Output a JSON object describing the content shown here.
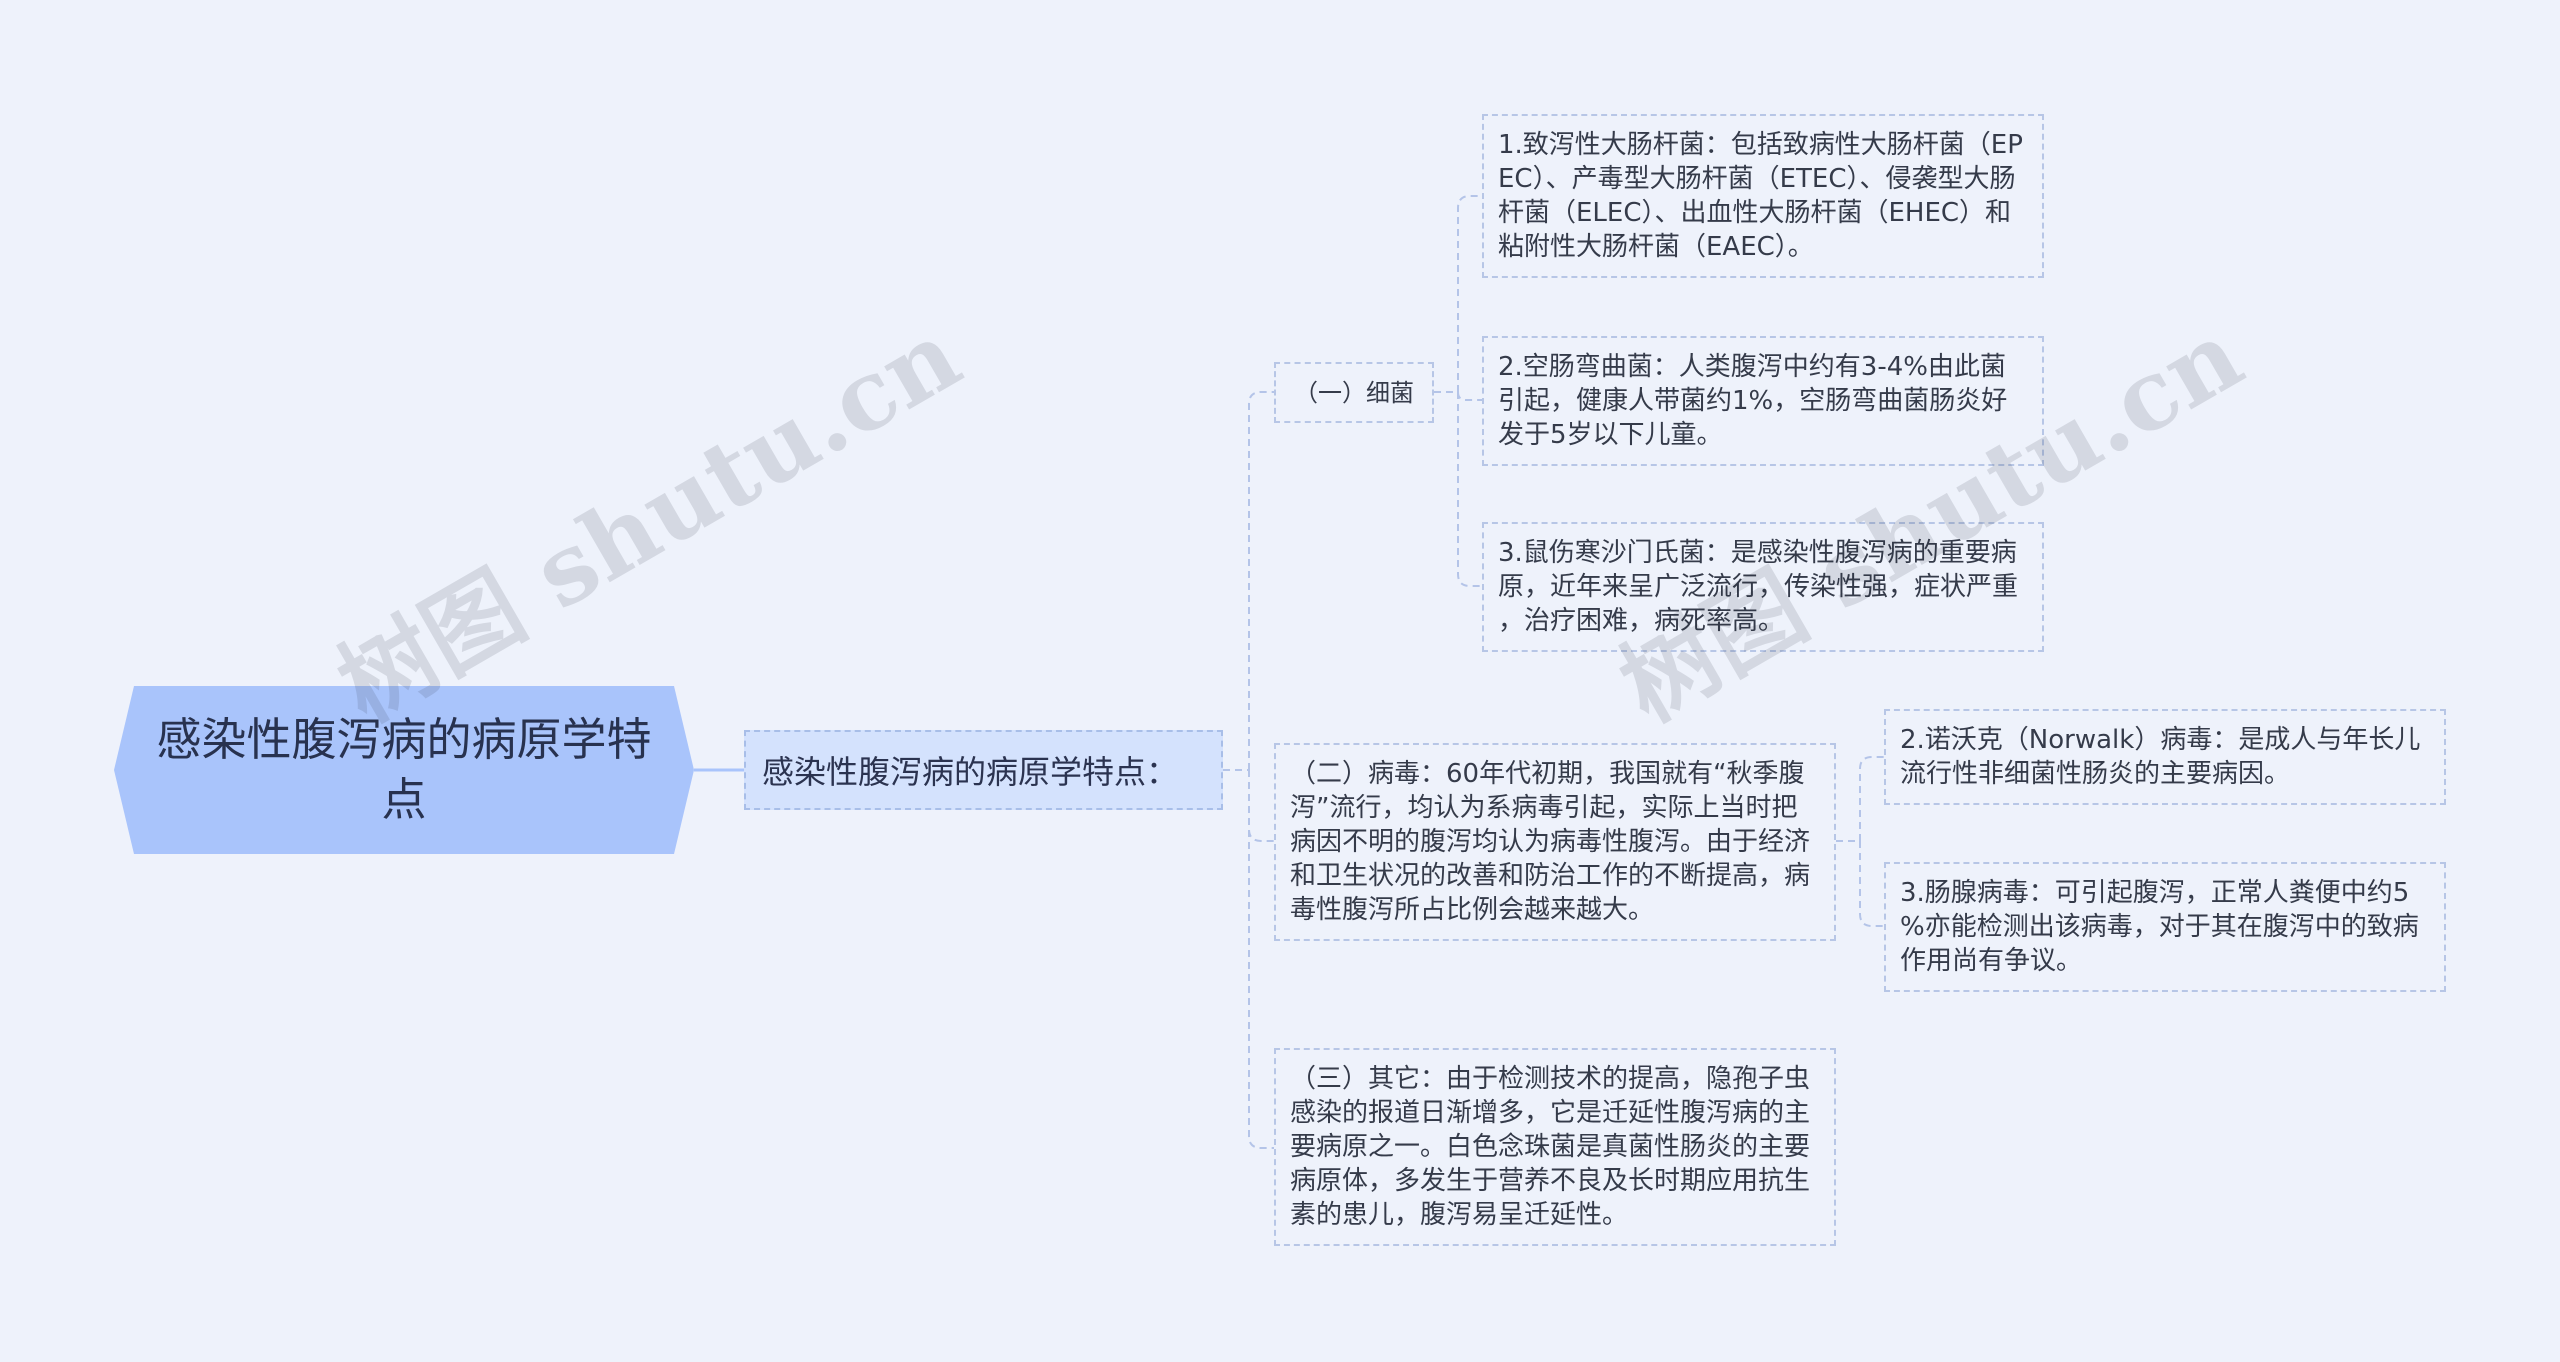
{
  "root": {
    "label": "感染性腹泻病的病原学特点"
  },
  "main": {
    "label": "感染性腹泻病的病原学特点："
  },
  "branches": [
    {
      "label": "（一）细菌",
      "children": [
        {
          "label": "1.致泻性大肠杆菌：包括致病性大肠杆菌（EPEC）、产毒型大肠杆菌（ETEC）、侵袭型大肠杆菌（ELEC）、出血性大肠杆菌（EHEC）和粘附性大肠杆菌（EAEC）。"
        },
        {
          "label": "2.空肠弯曲菌：人类腹泻中约有3-4%由此菌引起，健康人带菌约1%，空肠弯曲菌肠炎好发于5岁以下儿童。"
        },
        {
          "label": "3.鼠伤寒沙门氏菌：是感染性腹泻病的重要病原，近年来呈广泛流行，传染性强，症状严重，治疗困难，病死率高。"
        }
      ]
    },
    {
      "label": "（二）病毒：60年代初期，我国就有“秋季腹泻”流行，均认为系病毒引起，实际上当时把病因不明的腹泻均认为病毒性腹泻。由于经济和卫生状况的改善和防治工作的不断提高，病毒性腹泻所占比例会越来越大。",
      "children": [
        {
          "label": "2.诺沃克（Norwalk）病毒：是成人与年长儿流行性非细菌性肠炎的主要病因。"
        },
        {
          "label": "3.肠腺病毒：可引起腹泻，正常人粪便中约5%亦能检测出该病毒，对于其在腹泻中的致病作用尚有争议。"
        }
      ]
    },
    {
      "label": "（三）其它：由于检测技术的提高，隐孢子虫感染的报道日渐增多，它是迁延性腹泻病的主要病原之一。白色念珠菌是真菌性肠炎的主要病原体，多发生于营养不良及长时期应用抗生素的患儿，腹泻易呈迁延性。"
    }
  ],
  "watermark": "树图 shutu.cn",
  "colors": {
    "background": "#eef2fb",
    "root_fill": "#a9c4fb",
    "main_fill": "#d4e2fd",
    "border": "#b7c6e6",
    "line": "#b4c4e8"
  }
}
